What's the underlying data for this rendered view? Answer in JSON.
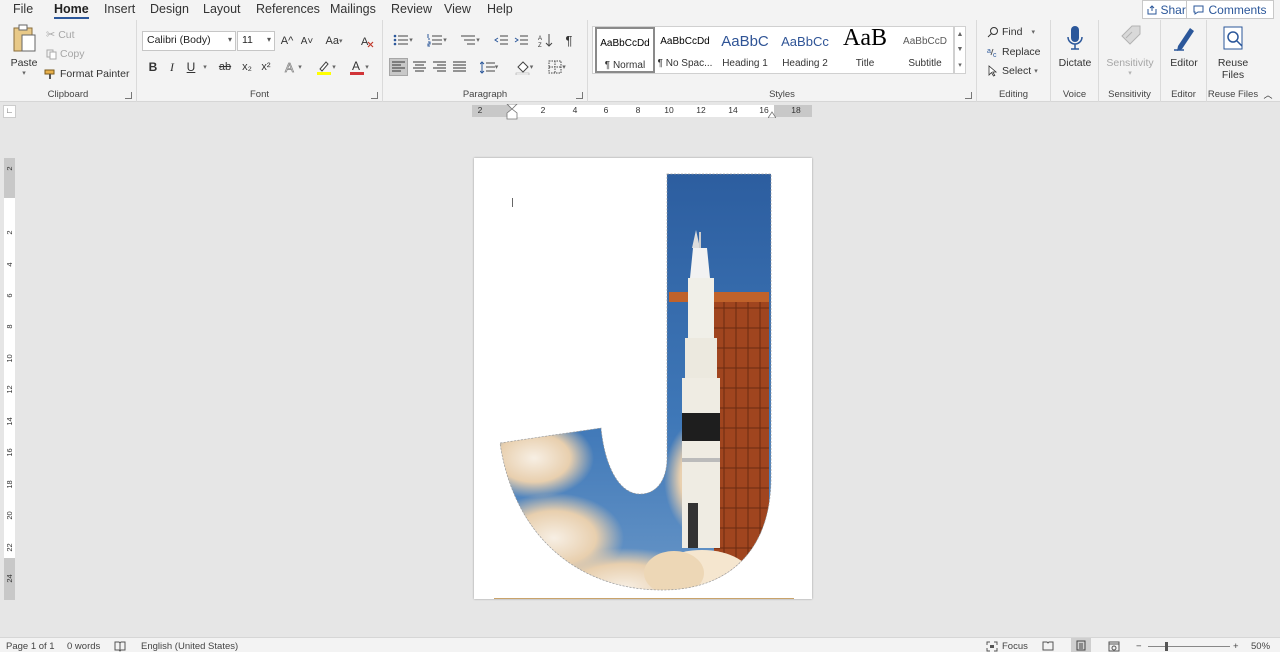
{
  "tabs": [
    "File",
    "Home",
    "Insert",
    "Design",
    "Layout",
    "References",
    "Mailings",
    "Review",
    "View",
    "Help"
  ],
  "active_tab": "Home",
  "share_label": "Share",
  "comments_label": "Comments",
  "clipboard": {
    "paste": "Paste",
    "cut": "Cut",
    "copy": "Copy",
    "format_painter": "Format Painter",
    "label": "Clipboard"
  },
  "font": {
    "name": "Calibri (Body)",
    "size": "11",
    "label": "Font",
    "bold": "B",
    "italic": "I",
    "underline": "U",
    "strike": "ab",
    "subscript": "x₂",
    "superscript": "x²",
    "grow": "A^",
    "shrink": "A˅",
    "case": "Aa",
    "font_color_glyph": "A",
    "font_color": "#d13438",
    "highlight_color": "#ffff00"
  },
  "paragraph": {
    "label": "Paragraph",
    "pilcrow": "¶"
  },
  "styles": {
    "label": "Styles",
    "items": [
      {
        "sample": "AaBbCcDd",
        "name": "¶ Normal",
        "selected": true
      },
      {
        "sample": "AaBbCcDd",
        "name": "¶ No Spac..."
      },
      {
        "sample": "AaBbC",
        "name": "Heading 1"
      },
      {
        "sample": "AaBbCc",
        "name": "Heading 2"
      },
      {
        "sample": "AaB",
        "name": "Title"
      },
      {
        "sample": "AaBbCcD",
        "name": "Subtitle"
      }
    ]
  },
  "editing": {
    "find": "Find",
    "replace": "Replace",
    "select": "Select",
    "label": "Editing"
  },
  "voice": {
    "dictate": "Dictate",
    "label": "Voice"
  },
  "sensitivity": {
    "button": "Sensitivity",
    "label": "Sensitivity"
  },
  "editor": {
    "button": "Editor",
    "label": "Editor"
  },
  "reuse": {
    "button_line1": "Reuse",
    "button_line2": "Files",
    "label": "Reuse Files"
  },
  "ruler_h": [
    "2",
    "2",
    "4",
    "6",
    "8",
    "10",
    "12",
    "14",
    "16",
    "18"
  ],
  "ruler_v": [
    "2",
    "2",
    "4",
    "6",
    "8",
    "10",
    "12",
    "14",
    "16",
    "18",
    "20",
    "22",
    "24"
  ],
  "status": {
    "page": "Page 1 of 1",
    "words": "0 words",
    "language": "English (United States)",
    "focus": "Focus",
    "zoom": "50%",
    "zoom_minus": "−",
    "zoom_plus": "+"
  }
}
